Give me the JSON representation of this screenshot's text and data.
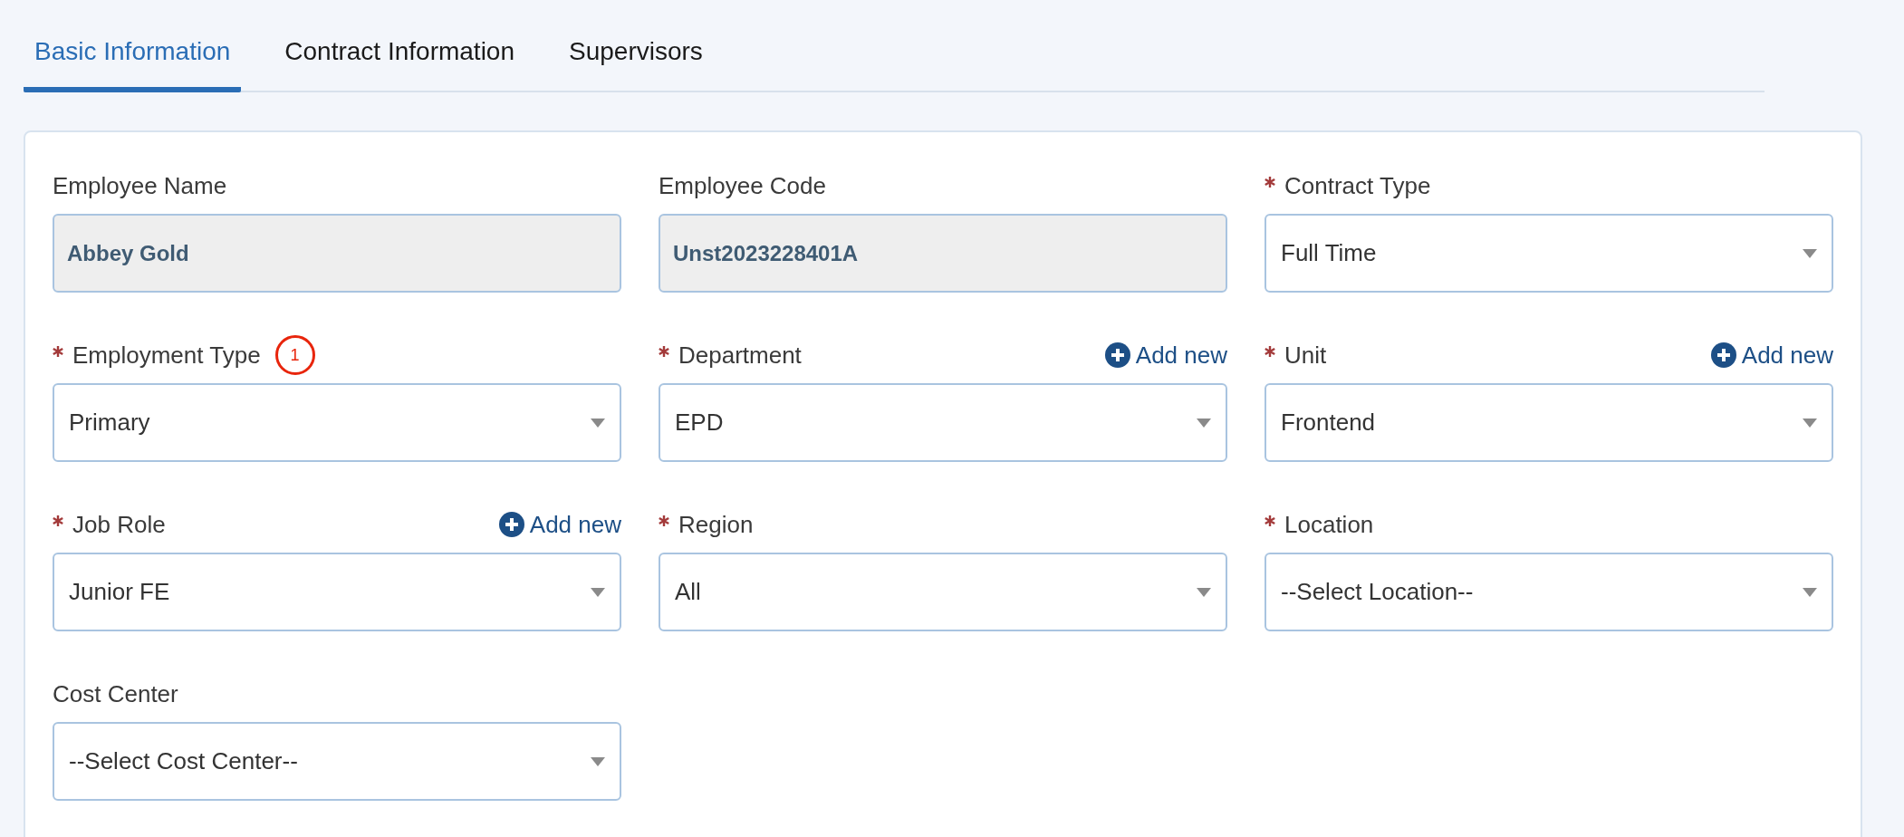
{
  "tabs": [
    {
      "label": "Basic Information",
      "selected": true
    },
    {
      "label": "Contract Information",
      "selected": false
    },
    {
      "label": "Supervisors",
      "selected": false
    }
  ],
  "fields": [
    {
      "label": "Employee Name",
      "kind": "readonly",
      "required": false,
      "value": "Abbey Gold"
    },
    {
      "label": "Employee Code",
      "kind": "readonly",
      "required": false,
      "value": "Unst2023228401A"
    },
    {
      "label": "Contract Type",
      "kind": "select",
      "required": true,
      "value": "Full Time"
    },
    {
      "label": "Employment Type",
      "kind": "select",
      "required": true,
      "value": "Primary",
      "marker": "1"
    },
    {
      "label": "Department",
      "kind": "select",
      "required": true,
      "value": "EPD",
      "add_new": "Add new"
    },
    {
      "label": "Unit",
      "kind": "select",
      "required": true,
      "value": "Frontend",
      "add_new": "Add new"
    },
    {
      "label": "Job Role",
      "kind": "select",
      "required": true,
      "value": "Junior FE",
      "add_new": "Add new"
    },
    {
      "label": "Region",
      "kind": "select",
      "required": true,
      "value": "All"
    },
    {
      "label": "Location",
      "kind": "select",
      "required": true,
      "value": "--Select Location--"
    },
    {
      "label": "Cost Center",
      "kind": "select",
      "required": false,
      "value": "--Select Cost Center--"
    }
  ]
}
